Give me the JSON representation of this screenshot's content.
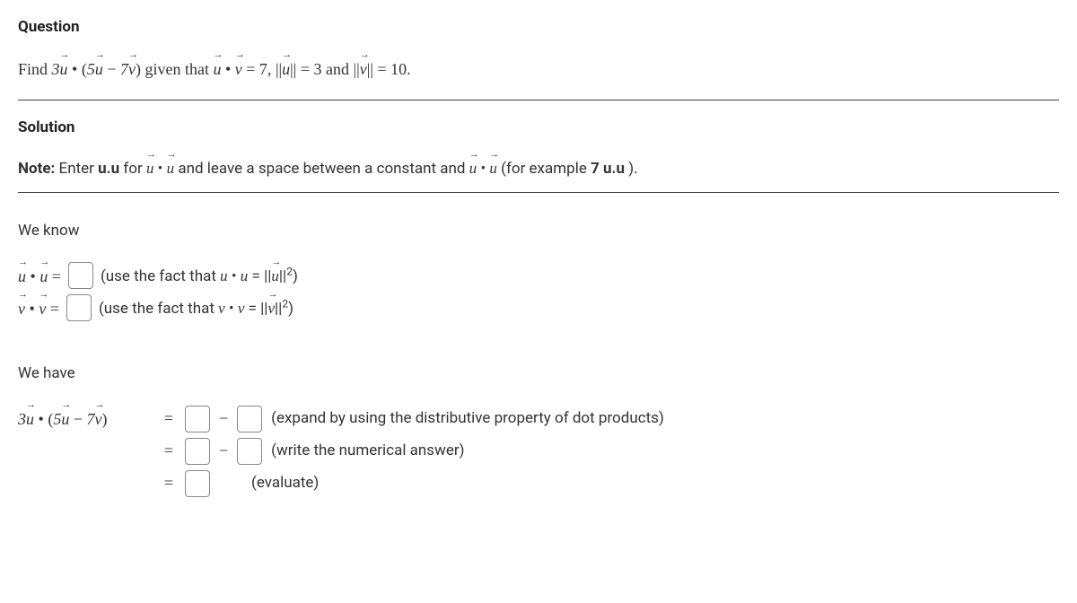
{
  "headings": {
    "question": "Question",
    "solution": "Solution",
    "weknow": "We know",
    "wehave": "We have"
  },
  "question": {
    "prefix": "Find ",
    "coef1": "3",
    "u": "u",
    "dot": " • ",
    "lpar": "(",
    "coef2": "5",
    "minus": " − ",
    "coef3": "7",
    "v": "v",
    "rpar": ")",
    "given": " given that ",
    "eq1_rhs": " = 7, ",
    "norm_u": " = 3",
    "and": " and ",
    "norm_v": " = 10."
  },
  "note": {
    "label": "Note:",
    "text1": " Enter ",
    "uu": "u.u",
    "text2": " for ",
    "text3": " and leave a space between a constant and ",
    "text4": " (for example ",
    "ex": "7 u.u",
    "text5": " )."
  },
  "hints": {
    "uu_pre": "(use the fact that ",
    "uu_mid": " = ",
    "uu_post": ")",
    "vv_pre": "(use the fact that ",
    "vv_post": ")",
    "expand": "(expand by using the distributive property of dot products)",
    "numeric": "(write the numerical answer)",
    "evaluate": "(evaluate)"
  },
  "sym": {
    "eq": "=",
    "minus": "−",
    "dot": "•",
    "u": "u",
    "v": "v",
    "normL": "||",
    "normR": "||",
    "sq": "2"
  }
}
